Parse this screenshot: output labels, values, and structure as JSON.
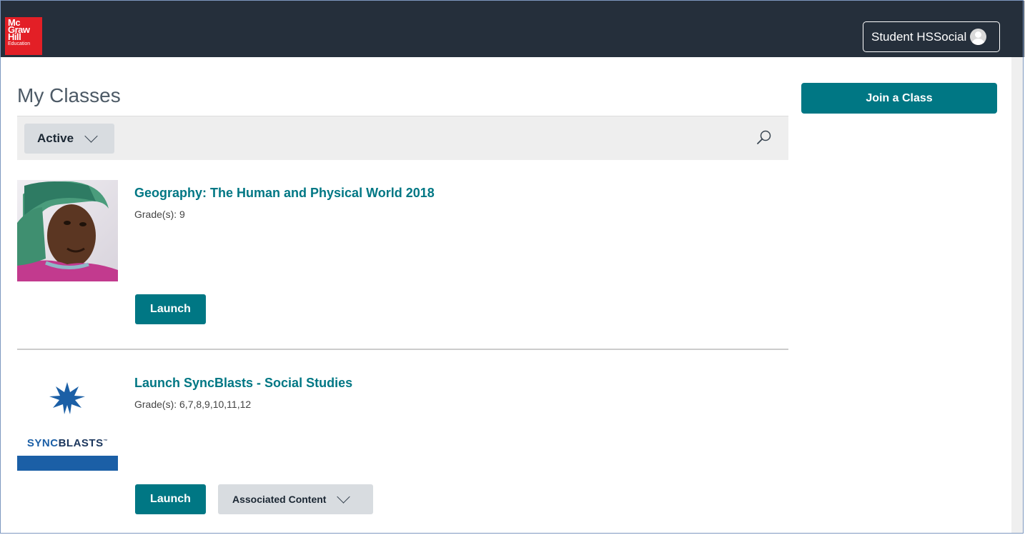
{
  "header": {
    "logo_lines": [
      "Mc",
      "Graw",
      "Hill",
      "Education"
    ],
    "user_name": "Student HSSocial"
  },
  "main": {
    "title": "My Classes",
    "join_label": "Join a Class",
    "filter": {
      "selected": "Active"
    }
  },
  "classes": [
    {
      "title": "Geography: The Human and Physical World 2018",
      "grades": "Grade(s): 9",
      "launch_label": "Launch"
    },
    {
      "title": "Launch SyncBlasts - Social Studies",
      "grades": "Grade(s): 6,7,8,9,10,11,12",
      "launch_label": "Launch",
      "associated_label": "Associated Content",
      "logo_text": {
        "part1": "SYNC",
        "part2": "BLASTS",
        "tm": "™"
      }
    }
  ],
  "colors": {
    "header_bg": "#252f3b",
    "accent": "#007784",
    "logo_red": "#e31f26",
    "sync_blue": "#1b5fa6"
  }
}
